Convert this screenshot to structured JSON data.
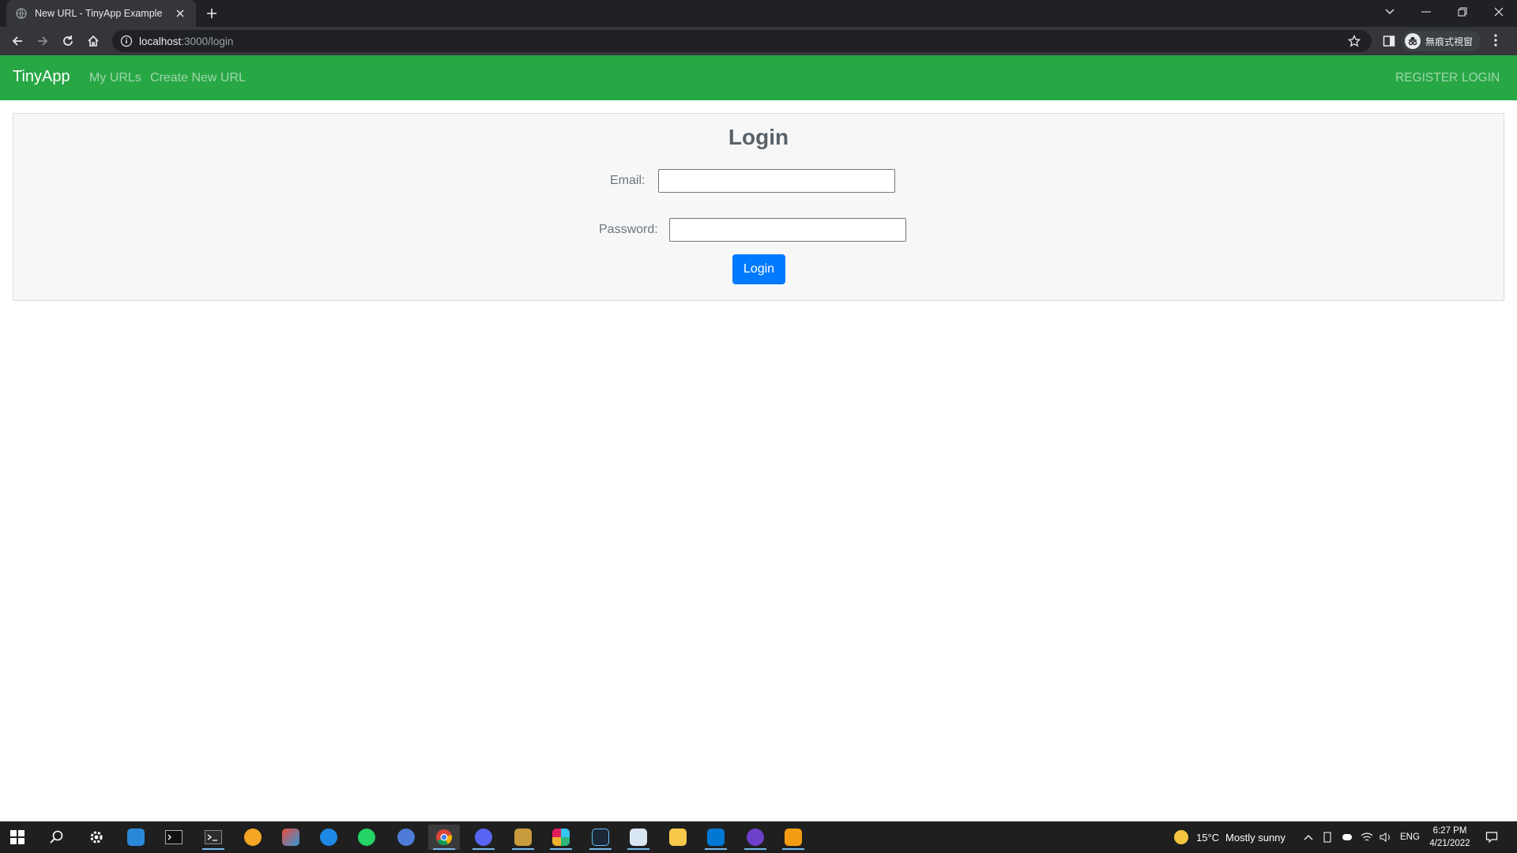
{
  "browser": {
    "tab_title": "New URL - TinyApp Example",
    "url_host": "localhost",
    "url_path": ":3000/login",
    "profile_label": "無痕式視窗"
  },
  "navbar": {
    "brand": "TinyApp",
    "links": [
      "My URLs",
      "Create New URL"
    ],
    "register": "REGISTER",
    "login": "LOGIN"
  },
  "login_form": {
    "heading": "Login",
    "email_label": "Email:",
    "email_value": "",
    "password_label": "Password:",
    "password_value": "",
    "submit_label": "Login"
  },
  "taskbar": {
    "apps": [
      "windows-start",
      "search",
      "settings",
      "news",
      "terminal",
      "powershell",
      "weather-app",
      "paint",
      "edge",
      "whatsapp",
      "chat",
      "chrome",
      "discord",
      "league",
      "slack",
      "steam",
      "notepad",
      "file-explorer",
      "vscode",
      "github-desktop",
      "media-player"
    ],
    "weather_temp": "15°C",
    "weather_text": "Mostly sunny",
    "language": "ENG",
    "time": "6:27 PM",
    "date": "4/21/2022"
  },
  "colors": {
    "navbar_bg": "#28a745",
    "button_bg": "#007bff",
    "chrome_dark": "#202124",
    "chrome_toolbar": "#35363a"
  }
}
